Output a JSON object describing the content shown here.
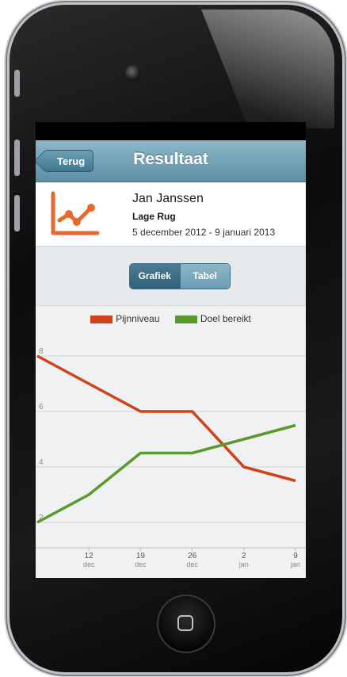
{
  "app": {
    "nav": {
      "back_label": "Terug",
      "title": "Resultaat"
    },
    "info": {
      "icon": "line-chart-icon",
      "name": "Jan Janssen",
      "area": "Lage Rug",
      "date_range": "5 december 2012 - 9 januari 2013"
    },
    "segment": {
      "grafiek_label": "Grafiek",
      "tabel_label": "Tabel",
      "selected": "Grafiek"
    }
  },
  "colors": {
    "pain": "#d0421a",
    "goal": "#5a9a2a",
    "nav": "#6f9fb3"
  },
  "chart_data": {
    "type": "line",
    "categories": [
      {
        "day": "12",
        "month": "dec"
      },
      {
        "day": "19",
        "month": "dec"
      },
      {
        "day": "26",
        "month": "dec"
      },
      {
        "day": "2",
        "month": "jan"
      },
      {
        "day": "9",
        "month": "jan"
      }
    ],
    "y_ticks": [
      "2",
      "4",
      "6",
      "8"
    ],
    "ylim": [
      2,
      8
    ],
    "grid": true,
    "legend_position": "top",
    "series": [
      {
        "name": "Pijnniveau",
        "color": "#d0421a",
        "x": [
          5,
          12,
          19,
          26,
          33,
          40
        ],
        "y": [
          8,
          7,
          6,
          6,
          4,
          3.5
        ]
      },
      {
        "name": "Doel bereikt",
        "color": "#5a9a2a",
        "x": [
          5,
          12,
          19,
          26,
          33,
          40
        ],
        "y": [
          2,
          3,
          4.5,
          4.5,
          5,
          5.5
        ]
      }
    ],
    "x_reference": "day offsets from 5 december 2012"
  }
}
